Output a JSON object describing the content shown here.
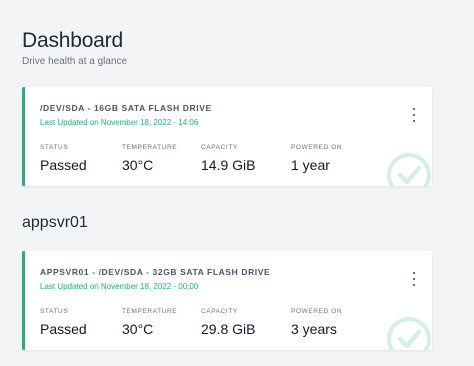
{
  "page": {
    "title": "Dashboard",
    "subtitle": "Drive health at a glance"
  },
  "section": {
    "title": "appsvr01"
  },
  "cards": [
    {
      "title": "/DEV/SDA - 16GB SATA FLASH DRIVE",
      "updated": "Last Updated on November 18, 2022 - 14:06",
      "stats": [
        {
          "label": "STATUS",
          "value": "Passed"
        },
        {
          "label": "TEMPERATURE",
          "value": "30°C"
        },
        {
          "label": "CAPACITY",
          "value": "14.9 GiB"
        },
        {
          "label": "POWERED ON",
          "value": "1 year"
        }
      ]
    },
    {
      "title": "APPSVR01 - /DEV/SDA - 32GB SATA FLASH DRIVE",
      "updated": "Last Updated on November 18, 2022 - 00:00",
      "stats": [
        {
          "label": "STATUS",
          "value": "Passed"
        },
        {
          "label": "TEMPERATURE",
          "value": "30°C"
        },
        {
          "label": "CAPACITY",
          "value": "29.8 GiB"
        },
        {
          "label": "POWERED ON",
          "value": "3 years"
        }
      ]
    }
  ],
  "icons": {
    "menu": "more-vertical-icon",
    "status": "check-circle-icon"
  },
  "colors": {
    "accent": "#22b07d",
    "watermark": "#d5efe5",
    "background": "#f3f4f6"
  }
}
